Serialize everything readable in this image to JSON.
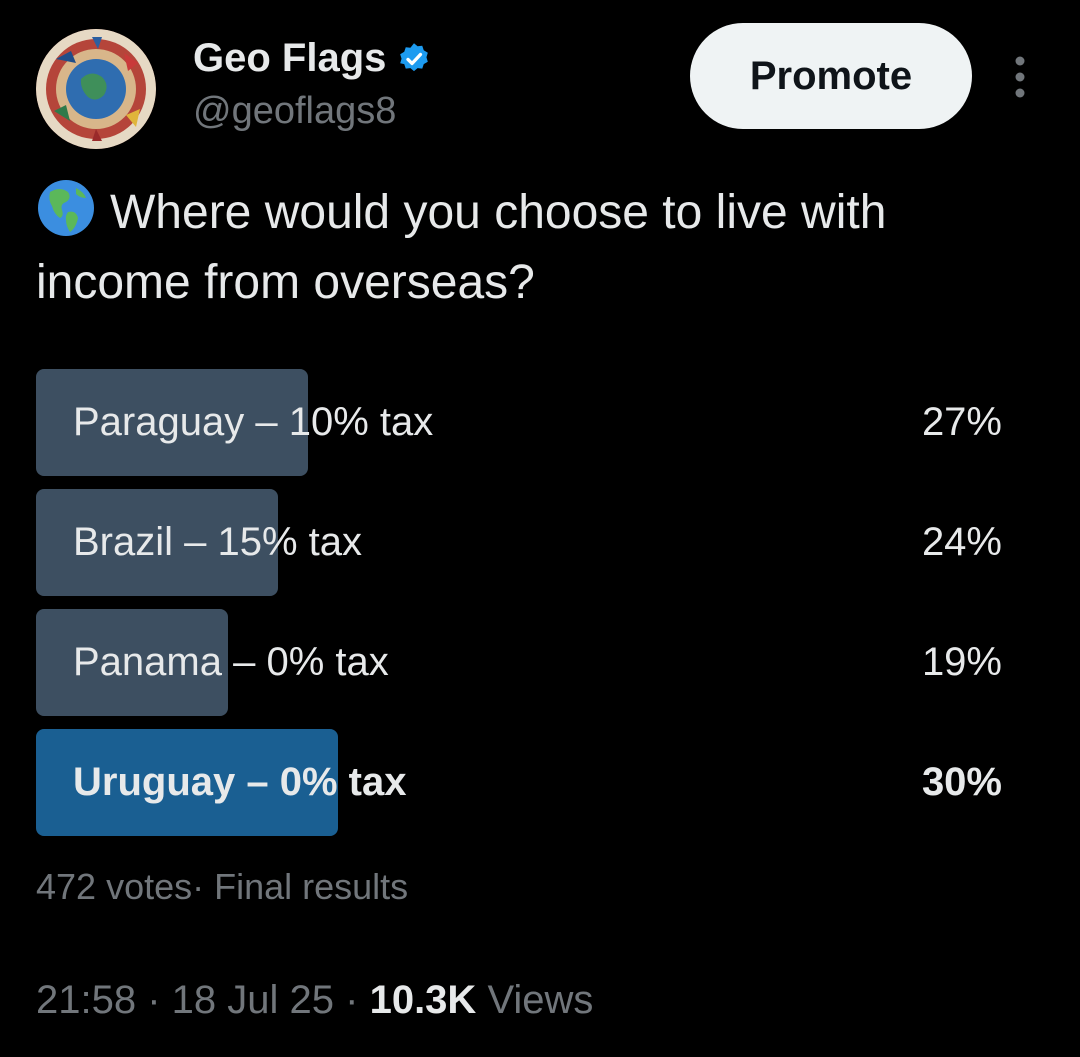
{
  "author": {
    "display_name": "Geo Flags",
    "handle": "@geoflags8",
    "verified_icon": "verified-badge-icon",
    "avatar_icon": "globe-collage-avatar"
  },
  "header": {
    "promote_label": "Promote",
    "more_icon": "more-vertical-icon"
  },
  "tweet": {
    "emoji_icon": "globe-americas-icon",
    "text": "Where would you choose to live with income from overseas?"
  },
  "poll": {
    "options": [
      {
        "label": "Paraguay – 10% tax",
        "percent_text": "27%",
        "percent": 27,
        "winner": false
      },
      {
        "label": "Brazil – 15% tax",
        "percent_text": "24%",
        "percent": 24,
        "winner": false
      },
      {
        "label": "Panama – 0% tax",
        "percent_text": "19%",
        "percent": 19,
        "winner": false
      },
      {
        "label": "Uruguay – 0% tax",
        "percent_text": "30%",
        "percent": 30,
        "winner": true
      }
    ],
    "meta": "472 votes· Final results"
  },
  "footer": {
    "time": "21:58",
    "date": "18 Jul 25",
    "views_count": "10.3K",
    "views_label": "Views"
  },
  "colors": {
    "background": "#000000",
    "text_primary": "#e7e9ea",
    "text_secondary": "#71767b",
    "bar_default": "#3d4f61",
    "bar_winner": "#1a5f92",
    "verified_blue": "#1d9bf0",
    "promote_bg": "#eff3f4"
  }
}
